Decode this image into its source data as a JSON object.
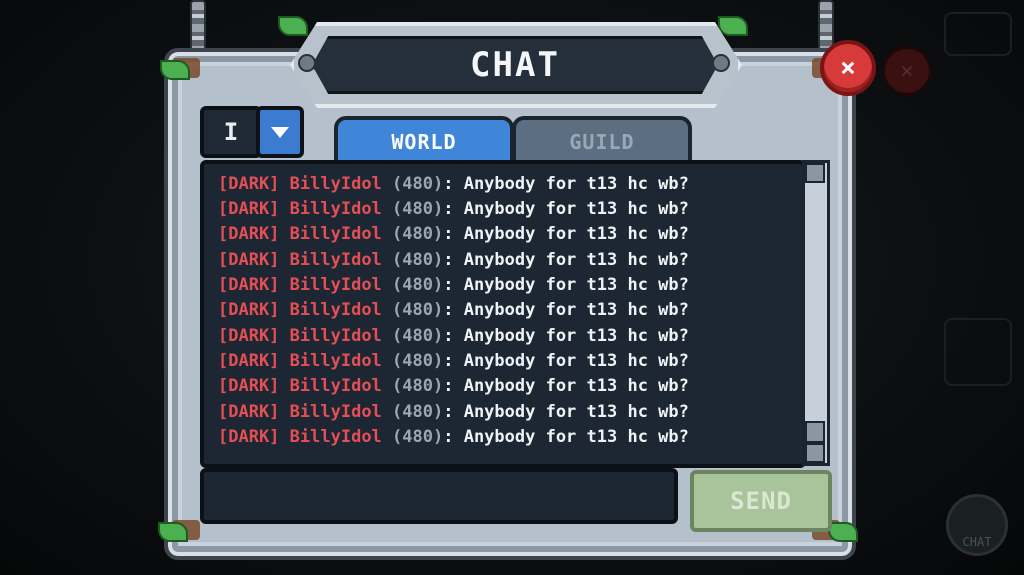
{
  "window": {
    "title": "CHAT"
  },
  "language": {
    "code": "I"
  },
  "tabs": [
    {
      "label": "WORLD",
      "active": true
    },
    {
      "label": "GUILD",
      "active": false
    }
  ],
  "messages": [
    {
      "tag": "[DARK]",
      "name": "BillyIdol",
      "level": "(480)",
      "text": ": Anybody for t13 hc wb?"
    },
    {
      "tag": "[DARK]",
      "name": "BillyIdol",
      "level": "(480)",
      "text": ": Anybody for t13 hc wb?"
    },
    {
      "tag": "[DARK]",
      "name": "BillyIdol",
      "level": "(480)",
      "text": ": Anybody for t13 hc wb?"
    },
    {
      "tag": "[DARK]",
      "name": "BillyIdol",
      "level": "(480)",
      "text": ": Anybody for t13 hc wb?"
    },
    {
      "tag": "[DARK]",
      "name": "BillyIdol",
      "level": "(480)",
      "text": ": Anybody for t13 hc wb?"
    },
    {
      "tag": "[DARK]",
      "name": "BillyIdol",
      "level": "(480)",
      "text": ": Anybody for t13 hc wb?"
    },
    {
      "tag": "[DARK]",
      "name": "BillyIdol",
      "level": "(480)",
      "text": ": Anybody for t13 hc wb?"
    },
    {
      "tag": "[DARK]",
      "name": "BillyIdol",
      "level": "(480)",
      "text": ": Anybody for t13 hc wb?"
    },
    {
      "tag": "[DARK]",
      "name": "BillyIdol",
      "level": "(480)",
      "text": ": Anybody for t13 hc wb?"
    },
    {
      "tag": "[DARK]",
      "name": "BillyIdol",
      "level": "(480)",
      "text": ": Anybody for t13 hc wb?"
    },
    {
      "tag": "[DARK]",
      "name": "BillyIdol",
      "level": "(480)",
      "text": ": Anybody for t13 hc wb?"
    }
  ],
  "input": {
    "value": "",
    "placeholder": ""
  },
  "send_label": "SEND",
  "close_label": "×",
  "side_chat_label": "CHAT",
  "colors": {
    "accent": "#3f86d9",
    "name": "#e44f55",
    "panel": "#b4c0cc",
    "send": "#a9c39a"
  }
}
